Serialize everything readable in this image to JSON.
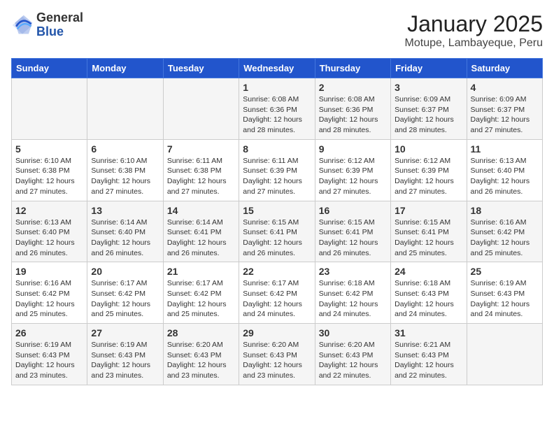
{
  "logo": {
    "general": "General",
    "blue": "Blue"
  },
  "title": "January 2025",
  "subtitle": "Motupe, Lambayeque, Peru",
  "days_of_week": [
    "Sunday",
    "Monday",
    "Tuesday",
    "Wednesday",
    "Thursday",
    "Friday",
    "Saturday"
  ],
  "weeks": [
    [
      {
        "day": "",
        "info": ""
      },
      {
        "day": "",
        "info": ""
      },
      {
        "day": "",
        "info": ""
      },
      {
        "day": "1",
        "info": "Sunrise: 6:08 AM\nSunset: 6:36 PM\nDaylight: 12 hours and 28 minutes."
      },
      {
        "day": "2",
        "info": "Sunrise: 6:08 AM\nSunset: 6:36 PM\nDaylight: 12 hours and 28 minutes."
      },
      {
        "day": "3",
        "info": "Sunrise: 6:09 AM\nSunset: 6:37 PM\nDaylight: 12 hours and 28 minutes."
      },
      {
        "day": "4",
        "info": "Sunrise: 6:09 AM\nSunset: 6:37 PM\nDaylight: 12 hours and 27 minutes."
      }
    ],
    [
      {
        "day": "5",
        "info": "Sunrise: 6:10 AM\nSunset: 6:38 PM\nDaylight: 12 hours and 27 minutes."
      },
      {
        "day": "6",
        "info": "Sunrise: 6:10 AM\nSunset: 6:38 PM\nDaylight: 12 hours and 27 minutes."
      },
      {
        "day": "7",
        "info": "Sunrise: 6:11 AM\nSunset: 6:38 PM\nDaylight: 12 hours and 27 minutes."
      },
      {
        "day": "8",
        "info": "Sunrise: 6:11 AM\nSunset: 6:39 PM\nDaylight: 12 hours and 27 minutes."
      },
      {
        "day": "9",
        "info": "Sunrise: 6:12 AM\nSunset: 6:39 PM\nDaylight: 12 hours and 27 minutes."
      },
      {
        "day": "10",
        "info": "Sunrise: 6:12 AM\nSunset: 6:39 PM\nDaylight: 12 hours and 27 minutes."
      },
      {
        "day": "11",
        "info": "Sunrise: 6:13 AM\nSunset: 6:40 PM\nDaylight: 12 hours and 26 minutes."
      }
    ],
    [
      {
        "day": "12",
        "info": "Sunrise: 6:13 AM\nSunset: 6:40 PM\nDaylight: 12 hours and 26 minutes."
      },
      {
        "day": "13",
        "info": "Sunrise: 6:14 AM\nSunset: 6:40 PM\nDaylight: 12 hours and 26 minutes."
      },
      {
        "day": "14",
        "info": "Sunrise: 6:14 AM\nSunset: 6:41 PM\nDaylight: 12 hours and 26 minutes."
      },
      {
        "day": "15",
        "info": "Sunrise: 6:15 AM\nSunset: 6:41 PM\nDaylight: 12 hours and 26 minutes."
      },
      {
        "day": "16",
        "info": "Sunrise: 6:15 AM\nSunset: 6:41 PM\nDaylight: 12 hours and 26 minutes."
      },
      {
        "day": "17",
        "info": "Sunrise: 6:15 AM\nSunset: 6:41 PM\nDaylight: 12 hours and 25 minutes."
      },
      {
        "day": "18",
        "info": "Sunrise: 6:16 AM\nSunset: 6:42 PM\nDaylight: 12 hours and 25 minutes."
      }
    ],
    [
      {
        "day": "19",
        "info": "Sunrise: 6:16 AM\nSunset: 6:42 PM\nDaylight: 12 hours and 25 minutes."
      },
      {
        "day": "20",
        "info": "Sunrise: 6:17 AM\nSunset: 6:42 PM\nDaylight: 12 hours and 25 minutes."
      },
      {
        "day": "21",
        "info": "Sunrise: 6:17 AM\nSunset: 6:42 PM\nDaylight: 12 hours and 25 minutes."
      },
      {
        "day": "22",
        "info": "Sunrise: 6:17 AM\nSunset: 6:42 PM\nDaylight: 12 hours and 24 minutes."
      },
      {
        "day": "23",
        "info": "Sunrise: 6:18 AM\nSunset: 6:42 PM\nDaylight: 12 hours and 24 minutes."
      },
      {
        "day": "24",
        "info": "Sunrise: 6:18 AM\nSunset: 6:43 PM\nDaylight: 12 hours and 24 minutes."
      },
      {
        "day": "25",
        "info": "Sunrise: 6:19 AM\nSunset: 6:43 PM\nDaylight: 12 hours and 24 minutes."
      }
    ],
    [
      {
        "day": "26",
        "info": "Sunrise: 6:19 AM\nSunset: 6:43 PM\nDaylight: 12 hours and 23 minutes."
      },
      {
        "day": "27",
        "info": "Sunrise: 6:19 AM\nSunset: 6:43 PM\nDaylight: 12 hours and 23 minutes."
      },
      {
        "day": "28",
        "info": "Sunrise: 6:20 AM\nSunset: 6:43 PM\nDaylight: 12 hours and 23 minutes."
      },
      {
        "day": "29",
        "info": "Sunrise: 6:20 AM\nSunset: 6:43 PM\nDaylight: 12 hours and 23 minutes."
      },
      {
        "day": "30",
        "info": "Sunrise: 6:20 AM\nSunset: 6:43 PM\nDaylight: 12 hours and 22 minutes."
      },
      {
        "day": "31",
        "info": "Sunrise: 6:21 AM\nSunset: 6:43 PM\nDaylight: 12 hours and 22 minutes."
      },
      {
        "day": "",
        "info": ""
      }
    ]
  ]
}
